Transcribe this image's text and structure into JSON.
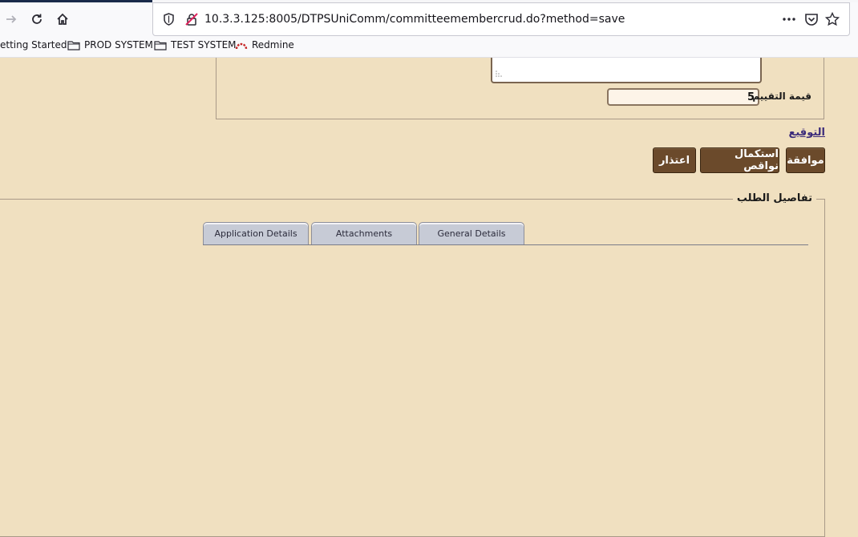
{
  "browser": {
    "url": "10.3.3.125:8005/DTPSUniComm/committeemembercrud.do?method=save",
    "bookmarks": [
      "etting Started",
      "PROD SYSTEM",
      "TEST SYSTEM",
      "Redmine"
    ]
  },
  "form": {
    "rating_label": "قيمة التقييم",
    "rating_value": "5",
    "signature_link": "التوقيع",
    "buttons": {
      "approve": "موافقة",
      "complete_missing": "استكمال نواقص",
      "decline": "اعتذار"
    }
  },
  "details": {
    "legend": "تفاصيل الطلب",
    "tabs": [
      "Application Details",
      "Attachments",
      "General Details"
    ]
  },
  "colors": {
    "page_bg": "#f0e0c0",
    "button_bg": "#6b4a2b",
    "tab_bg": "#c7cbd6"
  }
}
